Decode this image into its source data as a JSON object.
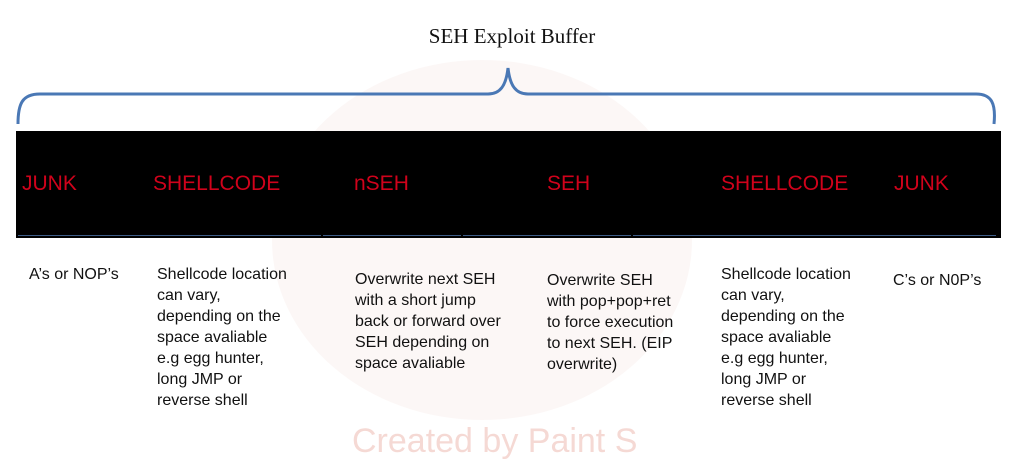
{
  "title": "SEH Exploit Buffer",
  "colors": {
    "bar": "#000000",
    "segment_text": "#d0021b",
    "brace": "#4a78b5"
  },
  "segments": [
    {
      "label": "JUNK",
      "description": "A’s or NOP’s"
    },
    {
      "label": "SHELLCODE",
      "description": "Shellcode location\ncan vary,\ndepending on the\nspace avaliable\ne.g egg hunter,\nlong JMP or\nreverse shell"
    },
    {
      "label": "nSEH",
      "description": "Overwrite next SEH\nwith a short jump\nback or forward over\nSEH depending on\nspace avaliable"
    },
    {
      "label": "SEH",
      "description": "Overwrite SEH\nwith pop+pop+ret\nto force execution\nto next SEH. (EIP\noverwrite)"
    },
    {
      "label": "SHELLCODE",
      "description": "Shellcode location\ncan vary,\ndepending on the\nspace avaliable\ne.g egg hunter,\nlong JMP or\nreverse shell"
    },
    {
      "label": "JUNK",
      "description": "C’s or N0P’s"
    }
  ],
  "watermark": "Created by Paint S"
}
